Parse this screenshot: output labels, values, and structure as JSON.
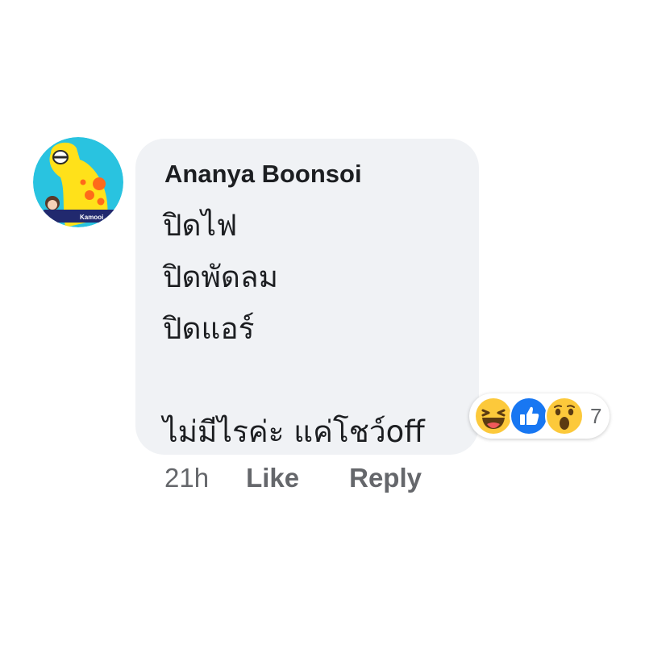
{
  "comment": {
    "author": "Ananya Boonsoi",
    "lines": [
      "ปิดไฟ",
      "ปิดพัดลม",
      "ปิดแอร์",
      "",
      "ไม่มีไรค่ะ แค่โชว์off"
    ]
  },
  "avatar": {
    "badge_text": "Kamooi",
    "colors": {
      "background": "#29c3e0",
      "creature": "#ffe11a",
      "spots": "#ff6a1a",
      "badge": "#21296e"
    }
  },
  "reactions": {
    "icons": [
      "haha-icon",
      "like-icon",
      "wow-icon"
    ],
    "count": "7",
    "colors": {
      "haha": "#fcc93b",
      "like": "#1877f2",
      "wow": "#fcc93b"
    }
  },
  "actions": {
    "time": "21h",
    "like_label": "Like",
    "reply_label": "Reply"
  }
}
